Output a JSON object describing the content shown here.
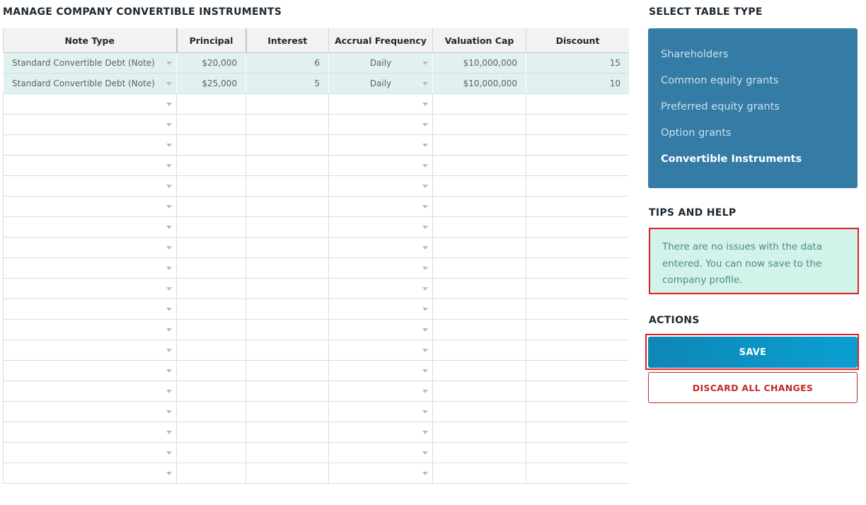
{
  "page_title": "MANAGE COMPANY CONVERTIBLE INSTRUMENTS",
  "table": {
    "headers": [
      "Note Type",
      "Principal",
      "Interest",
      "Accrual Frequency",
      "Valuation Cap",
      "Discount"
    ],
    "rows": [
      {
        "note_type": "Standard Convertible Debt (Note)",
        "principal": "$20,000",
        "interest": "6",
        "accrual_frequency": "Daily",
        "valuation_cap": "$10,000,000",
        "discount": "15"
      },
      {
        "note_type": "Standard Convertible Debt (Note)",
        "principal": "$25,000",
        "interest": "5",
        "accrual_frequency": "Daily",
        "valuation_cap": "$10,000,000",
        "discount": "10"
      }
    ],
    "empty_row_count": 19
  },
  "select_table_type": {
    "heading": "SELECT TABLE TYPE",
    "items": [
      {
        "label": "Shareholders",
        "active": false
      },
      {
        "label": "Common equity grants",
        "active": false
      },
      {
        "label": "Preferred equity grants",
        "active": false
      },
      {
        "label": "Option grants",
        "active": false
      },
      {
        "label": "Convertible Instruments",
        "active": true
      }
    ]
  },
  "tips": {
    "heading": "TIPS AND HELP",
    "message": "There are no issues with the data entered. You can now save to the company profile."
  },
  "actions": {
    "heading": "ACTIONS",
    "save_label": "SAVE",
    "discard_label": "DISCARD ALL CHANGES"
  },
  "colors": {
    "panel_bg": "#347ba6",
    "tips_bg": "#d2f3ea",
    "highlight_border": "#de1f25",
    "save_bg": "#0b9fd1",
    "discard_text": "#c42a2a",
    "filled_row_bg": "#e1f1ef"
  },
  "icons": {
    "dropdown": "caret-down-icon"
  }
}
